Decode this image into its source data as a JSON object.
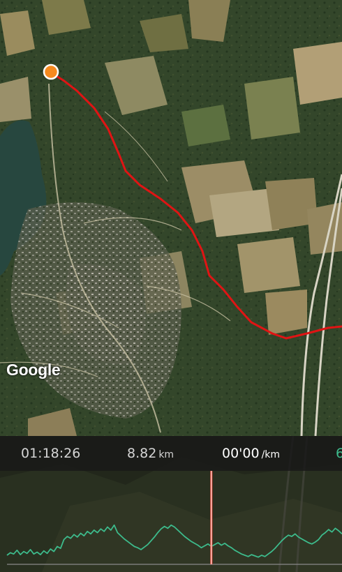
{
  "map": {
    "attribution": "Google",
    "route_color": "#e01414",
    "start_marker_color": "#f58a1f"
  },
  "stats": {
    "time": "01:18:26",
    "distance_value": "8.82",
    "distance_unit": "km",
    "pace_value": "00'00",
    "pace_unit": "/km",
    "extra_value": "6"
  },
  "elevation_chart": {
    "line_color": "#3dbb8c",
    "cursor_color": "#ff4a3a",
    "cursor_position": 0.61,
    "profile": [
      0.1,
      0.14,
      0.12,
      0.18,
      0.11,
      0.16,
      0.13,
      0.19,
      0.12,
      0.15,
      0.11,
      0.17,
      0.13,
      0.2,
      0.16,
      0.24,
      0.21,
      0.35,
      0.4,
      0.37,
      0.43,
      0.39,
      0.45,
      0.41,
      0.48,
      0.44,
      0.5,
      0.46,
      0.52,
      0.48,
      0.55,
      0.5,
      0.58,
      0.46,
      0.41,
      0.36,
      0.32,
      0.28,
      0.24,
      0.22,
      0.19,
      0.23,
      0.27,
      0.33,
      0.39,
      0.46,
      0.52,
      0.56,
      0.53,
      0.58,
      0.55,
      0.5,
      0.45,
      0.4,
      0.36,
      0.32,
      0.29,
      0.26,
      0.22,
      0.25,
      0.28,
      0.24,
      0.27,
      0.3,
      0.26,
      0.29,
      0.25,
      0.22,
      0.18,
      0.15,
      0.12,
      0.1,
      0.08,
      0.11,
      0.09,
      0.07,
      0.1,
      0.08,
      0.12,
      0.16,
      0.21,
      0.27,
      0.33,
      0.38,
      0.42,
      0.4,
      0.44,
      0.39,
      0.36,
      0.33,
      0.3,
      0.28,
      0.31,
      0.35,
      0.42,
      0.46,
      0.51,
      0.47,
      0.53,
      0.49,
      0.44
    ]
  }
}
